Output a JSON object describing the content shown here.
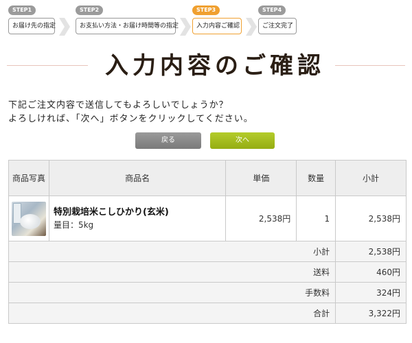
{
  "steps": [
    {
      "badge": "STEP1",
      "label": "お届け先の指定"
    },
    {
      "badge": "STEP2",
      "label": "お支払い方法・お届け時間等の指定"
    },
    {
      "badge": "STEP3",
      "label": "入力内容ご確認"
    },
    {
      "badge": "STEP4",
      "label": "ご注文完了"
    }
  ],
  "title": "入力内容のご確認",
  "message": {
    "line1": "下記ご注文内容で送信してもよろしいでしょうか？",
    "line2": "よろしければ、「次へ」ボタンをクリックしてください。"
  },
  "buttons": {
    "back": "戻る",
    "next": "次へ"
  },
  "table": {
    "headers": {
      "photo": "商品写真",
      "name": "商品名",
      "price": "単価",
      "qty": "数量",
      "subtotal": "小計"
    },
    "item": {
      "name": "特別栽培米こしひかり(玄米)",
      "weight": "量目：5kg",
      "price": "2,538円",
      "qty": "1",
      "subtotal": "2,538円"
    },
    "summary": [
      {
        "label": "小計",
        "value": "2,538円"
      },
      {
        "label": "送料",
        "value": "460円"
      },
      {
        "label": "手数料",
        "value": "324円"
      },
      {
        "label": "合計",
        "value": "3,322円"
      }
    ]
  },
  "colors": {
    "current_step": "#f0a030",
    "next_button": "#a5bd1e",
    "back_button": "#8a8a8a"
  }
}
